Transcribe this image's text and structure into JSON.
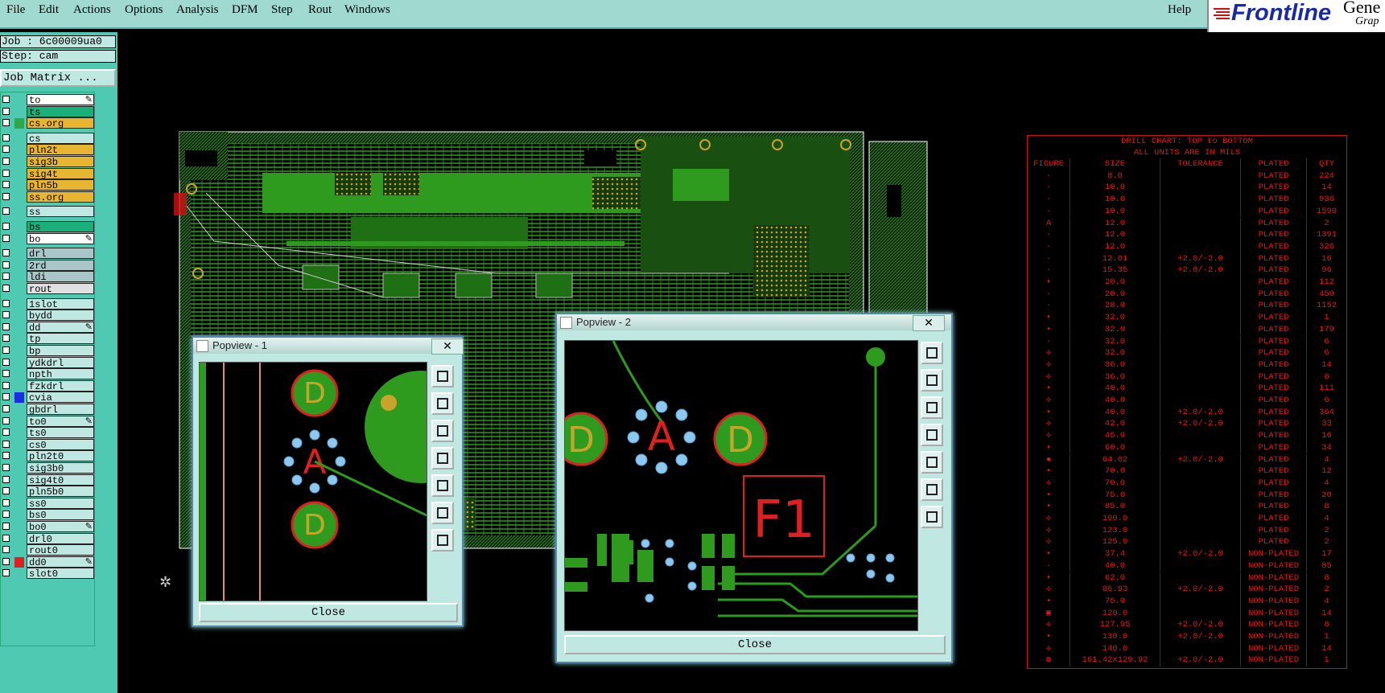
{
  "menu": {
    "items": [
      "File",
      "Edit",
      "Actions",
      "Options",
      "Analysis",
      "DFM",
      "Step",
      "Rout",
      "Windows"
    ],
    "help": "Help"
  },
  "brand": {
    "name": "Frontline",
    "partial_right": "Gene",
    "partial_sub": "Grap"
  },
  "job": {
    "job_line": "Job : 6c00009ua0",
    "step_line": "Step: cam",
    "matrix_button": "Job Matrix ..."
  },
  "layers": [
    {
      "name": "to",
      "color": "#ffffff",
      "mark": "pen"
    },
    {
      "name": "ts",
      "color": "#19b07a"
    },
    {
      "name": "cs.org",
      "color": "#e8b531",
      "swatch": "#2fa84a"
    },
    {
      "name": "cs",
      "color": "#bfe8e2"
    },
    {
      "name": "pln2t",
      "color": "#e8b531"
    },
    {
      "name": "sig3b",
      "color": "#e8b531"
    },
    {
      "name": "sig4t",
      "color": "#e8b531"
    },
    {
      "name": "pln5b",
      "color": "#e8b531"
    },
    {
      "name": "ss.org",
      "color": "#e8b531"
    },
    {
      "name": "ss",
      "color": "#bfe8e2"
    },
    {
      "name": "bs",
      "color": "#19b07a"
    },
    {
      "name": "bo",
      "color": "#ffffff",
      "mark": "pen"
    },
    {
      "name": "drl",
      "color": "#a9c6c8"
    },
    {
      "name": "2rd",
      "color": "#a9c6c8"
    },
    {
      "name": "ldi",
      "color": "#a9c6c8"
    },
    {
      "name": "rout",
      "color": "#e0e0e0"
    },
    {
      "name": "1slot",
      "color": "#bfe8e2"
    },
    {
      "name": "bydd",
      "color": "#bfe8e2"
    },
    {
      "name": "dd",
      "color": "#bfe8e2",
      "mark": "pen"
    },
    {
      "name": "tp",
      "color": "#bfe8e2"
    },
    {
      "name": "bp",
      "color": "#bfe8e2"
    },
    {
      "name": "ydkdrl",
      "color": "#bfe8e2"
    },
    {
      "name": "npth",
      "color": "#bfe8e2"
    },
    {
      "name": "fzkdrl",
      "color": "#bfe8e2"
    },
    {
      "name": "cvia",
      "color": "#bfe8e2",
      "swatch": "#1a2ee0"
    },
    {
      "name": "gbdrl",
      "color": "#bfe8e2"
    },
    {
      "name": "to0",
      "color": "#bfe8e2",
      "mark": "pen"
    },
    {
      "name": "ts0",
      "color": "#bfe8e2"
    },
    {
      "name": "cs0",
      "color": "#bfe8e2"
    },
    {
      "name": "pln2t0",
      "color": "#bfe8e2"
    },
    {
      "name": "sig3b0",
      "color": "#bfe8e2"
    },
    {
      "name": "sig4t0",
      "color": "#bfe8e2"
    },
    {
      "name": "pln5b0",
      "color": "#bfe8e2"
    },
    {
      "name": "ss0",
      "color": "#bfe8e2"
    },
    {
      "name": "bs0",
      "color": "#bfe8e2"
    },
    {
      "name": "bo0",
      "color": "#bfe8e2",
      "mark": "pen"
    },
    {
      "name": "drl0",
      "color": "#bfe8e2"
    },
    {
      "name": "rout0",
      "color": "#bfe8e2"
    },
    {
      "name": "dd0",
      "color": "#bfe8e2",
      "swatch": "#e02020",
      "mark": "pen"
    },
    {
      "name": "slot0",
      "color": "#bfe8e2"
    }
  ],
  "drill_chart": {
    "title": "DRILL CHART: TOP to BOTTOM",
    "subtitle": "ALL UNITS ARE IN MILS",
    "headers": [
      "FIGURE",
      "SIZE",
      "TOLERANCE",
      "PLATED",
      "QTY"
    ],
    "rows": [
      [
        "·",
        "8.0",
        "",
        "PLATED",
        "224"
      ],
      [
        "·",
        "10.0",
        "",
        "PLATED",
        "14"
      ],
      [
        "·",
        "10.0",
        "",
        "PLATED",
        "936"
      ],
      [
        "·",
        "10.0",
        "",
        "PLATED",
        "1590"
      ],
      [
        "A",
        "12.0",
        "",
        "PLATED",
        "2"
      ],
      [
        "·",
        "12.0",
        "",
        "PLATED",
        "1391"
      ],
      [
        "·",
        "12.0",
        "",
        "PLATED",
        "326"
      ],
      [
        "·",
        "12.01",
        "+2.0/-2.0",
        "PLATED",
        "16"
      ],
      [
        "·",
        "15.35",
        "+2.0/-2.0",
        "PLATED",
        "96"
      ],
      [
        "•",
        "20.0",
        "",
        "PLATED",
        "112"
      ],
      [
        "·",
        "20.0",
        "",
        "PLATED",
        "459"
      ],
      [
        "·",
        "28.0",
        "",
        "PLATED",
        "1152"
      ],
      [
        "•",
        "32.0",
        "",
        "PLATED",
        "1"
      ],
      [
        "•",
        "32.0",
        "",
        "PLATED",
        "179"
      ],
      [
        "·",
        "32.0",
        "",
        "PLATED",
        "6"
      ],
      [
        "✢",
        "32.0",
        "",
        "PLATED",
        "6"
      ],
      [
        "✢",
        "36.0",
        "",
        "PLATED",
        "14"
      ],
      [
        "✢",
        "36.0",
        "",
        "PLATED",
        "8"
      ],
      [
        "•",
        "40.0",
        "",
        "PLATED",
        "111"
      ],
      [
        "✢",
        "40.0",
        "",
        "PLATED",
        "6"
      ],
      [
        "•",
        "40.0",
        "+2.0/-2.0",
        "PLATED",
        "364"
      ],
      [
        "✢",
        "42.0",
        "+2.0/-2.0",
        "PLATED",
        "33"
      ],
      [
        "✢",
        "45.0",
        "",
        "PLATED",
        "16"
      ],
      [
        "•",
        "60.0",
        "",
        "PLATED",
        "34"
      ],
      [
        "●",
        "64.02",
        "+2.0/-2.0",
        "PLATED",
        "4"
      ],
      [
        "•",
        "70.0",
        "",
        "PLATED",
        "12"
      ],
      [
        "✢",
        "70.0",
        "",
        "PLATED",
        "4"
      ],
      [
        "•",
        "75.0",
        "",
        "PLATED",
        "20"
      ],
      [
        "•",
        "85.0",
        "",
        "PLATED",
        "8"
      ],
      [
        "✢",
        "100.0",
        "",
        "PLATED",
        "4"
      ],
      [
        "✢",
        "123.0",
        "",
        "PLATED",
        "2"
      ],
      [
        "✢",
        "125.0",
        "",
        "PLATED",
        "2"
      ],
      [
        "•",
        "37.4",
        "+2.0/-2.0",
        "NON-PLATED",
        "17"
      ],
      [
        "·",
        "40.0",
        "",
        "NON-PLATED",
        "85"
      ],
      [
        "•",
        "62.0",
        "",
        "NON-PLATED",
        "8"
      ],
      [
        "✢",
        "86.93",
        "+2.0/-2.0",
        "NON-PLATED",
        "2"
      ],
      [
        "•",
        "75.0",
        "",
        "NON-PLATED",
        "4"
      ],
      [
        "▣",
        "120.0",
        "",
        "NON-PLATED",
        "14"
      ],
      [
        "✢",
        "127.95",
        "+2.0/-2.0",
        "NON-PLATED",
        "8"
      ],
      [
        "•",
        "130.0",
        "+2.0/-2.0",
        "NON-PLATED",
        "1"
      ],
      [
        "✢",
        "140.0",
        "",
        "NON-PLATED",
        "14"
      ],
      [
        "◍",
        "161.42x129.92",
        "+2.0/-2.0",
        "NON-PLATED",
        "1"
      ]
    ]
  },
  "popview1": {
    "title": "Popview - 1",
    "close": "Close",
    "labels": [
      "D",
      "A",
      "D"
    ]
  },
  "popview2": {
    "title": "Popview - 2",
    "close": "Close",
    "labels": [
      "D",
      "A",
      "D",
      "F1"
    ]
  },
  "colors": {
    "menubar": "#9fd9d0",
    "panel": "#4fc9b2",
    "chart_red": "#e51818",
    "copper": "#2e9a1e"
  }
}
